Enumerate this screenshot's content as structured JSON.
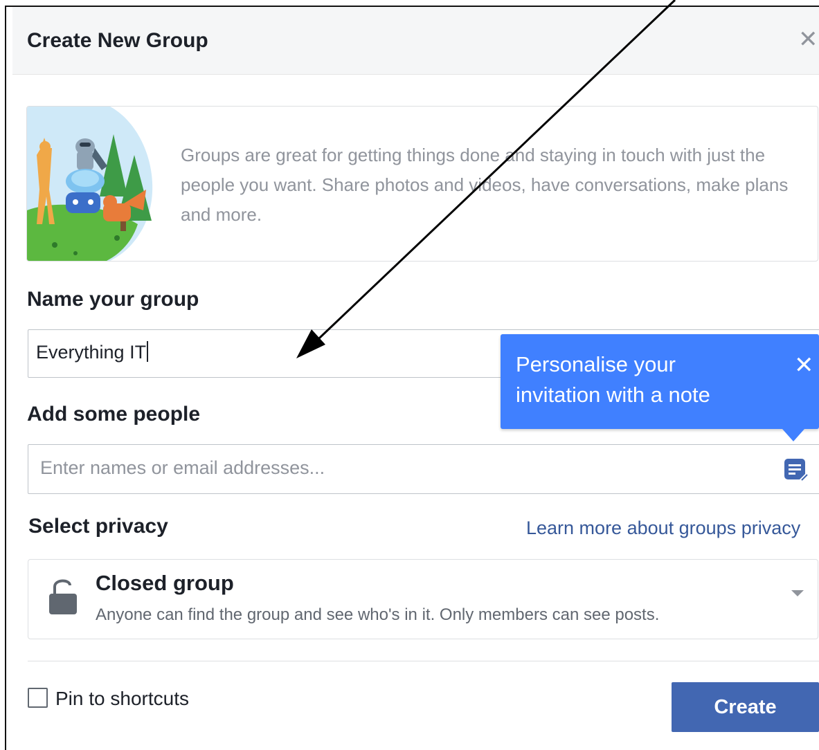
{
  "dialog": {
    "title": "Create New Group",
    "close_icon": "close-icon"
  },
  "intro": {
    "text": "Groups are great for getting things done and staying in touch with just the people you want. Share photos and videos, have conversations, make plans and more."
  },
  "name_section": {
    "label": "Name your group",
    "value": "Everything IT"
  },
  "people_section": {
    "label": "Add some people",
    "placeholder": "Enter names or email addresses...",
    "note_icon": "note-icon"
  },
  "tooltip": {
    "text": "Personalise your invitation with a note",
    "close_icon": "close-icon"
  },
  "privacy": {
    "label": "Select privacy",
    "learn_more_link": "Learn more about groups privacy",
    "selected": {
      "name": "Closed group",
      "description": "Anyone can find the group and see who's in it. Only members can see posts.",
      "icon": "lock-icon"
    }
  },
  "footer": {
    "pin_label": "Pin to shortcuts",
    "pin_checked": false,
    "create_label": "Create"
  },
  "colors": {
    "primary": "#4267b2",
    "tooltip": "#4080ff",
    "link": "#365899",
    "header_bg": "#f5f6f7"
  }
}
